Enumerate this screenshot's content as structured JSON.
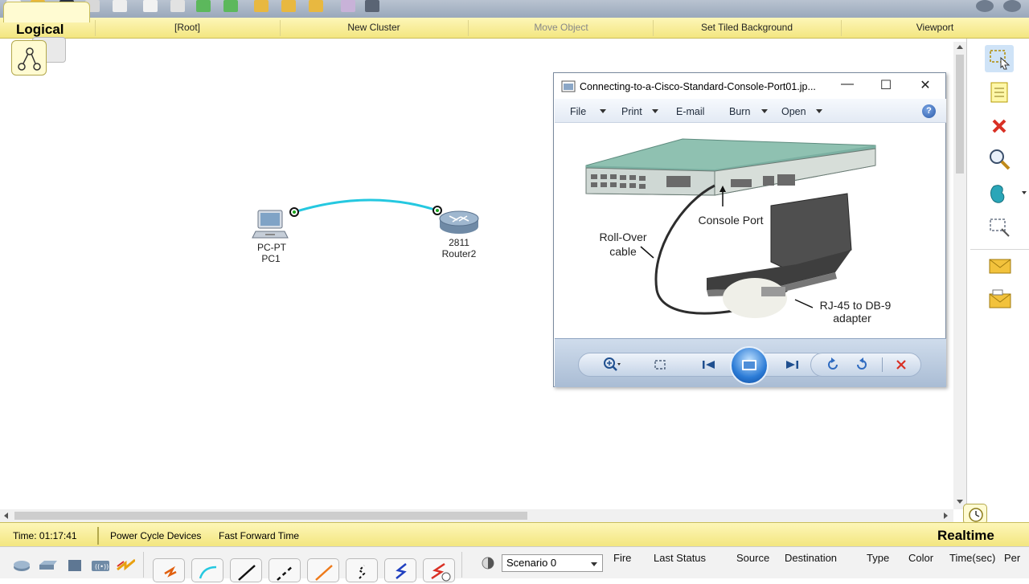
{
  "logical_bar": {
    "title": "Logical",
    "root": "[Root]",
    "new_cluster": "New Cluster",
    "move_object": "Move Object",
    "set_tiled_background": "Set Tiled Background",
    "viewport": "Viewport"
  },
  "devices": [
    {
      "type": "PC-PT",
      "name": "PC1",
      "icon": "pc-icon"
    },
    {
      "type": "2811",
      "name": "Router2",
      "icon": "router-icon"
    }
  ],
  "link": {
    "color": "#25c8e0",
    "endpoint_color": "#1aa31a"
  },
  "viewer": {
    "title": "Connecting-to-a-Cisco-Standard-Console-Port01.jp...",
    "menu": [
      "File",
      "Print",
      "E-mail",
      "Burn",
      "Open"
    ],
    "image_labels": {
      "console_port": "Console Port",
      "rollover_line1": "Roll-Over",
      "rollover_line2": "cable",
      "adapter_line1": "RJ-45 to DB-9",
      "adapter_line2": "adapter"
    }
  },
  "status_bar": {
    "time": "Time: 01:17:41",
    "power_cycle": "Power Cycle Devices",
    "fast_forward": "Fast Forward Time",
    "mode": "Realtime"
  },
  "bottom_panel": {
    "scenario": "Scenario 0",
    "pdu_columns": [
      "Fire",
      "Last Status",
      "Source",
      "Destination",
      "Type",
      "Color",
      "Time(sec)",
      "Per"
    ]
  },
  "colors": {
    "yellow_bar": "#f7ec96",
    "accent_blue": "#2b7bd6",
    "delete_red": "#d93025"
  }
}
